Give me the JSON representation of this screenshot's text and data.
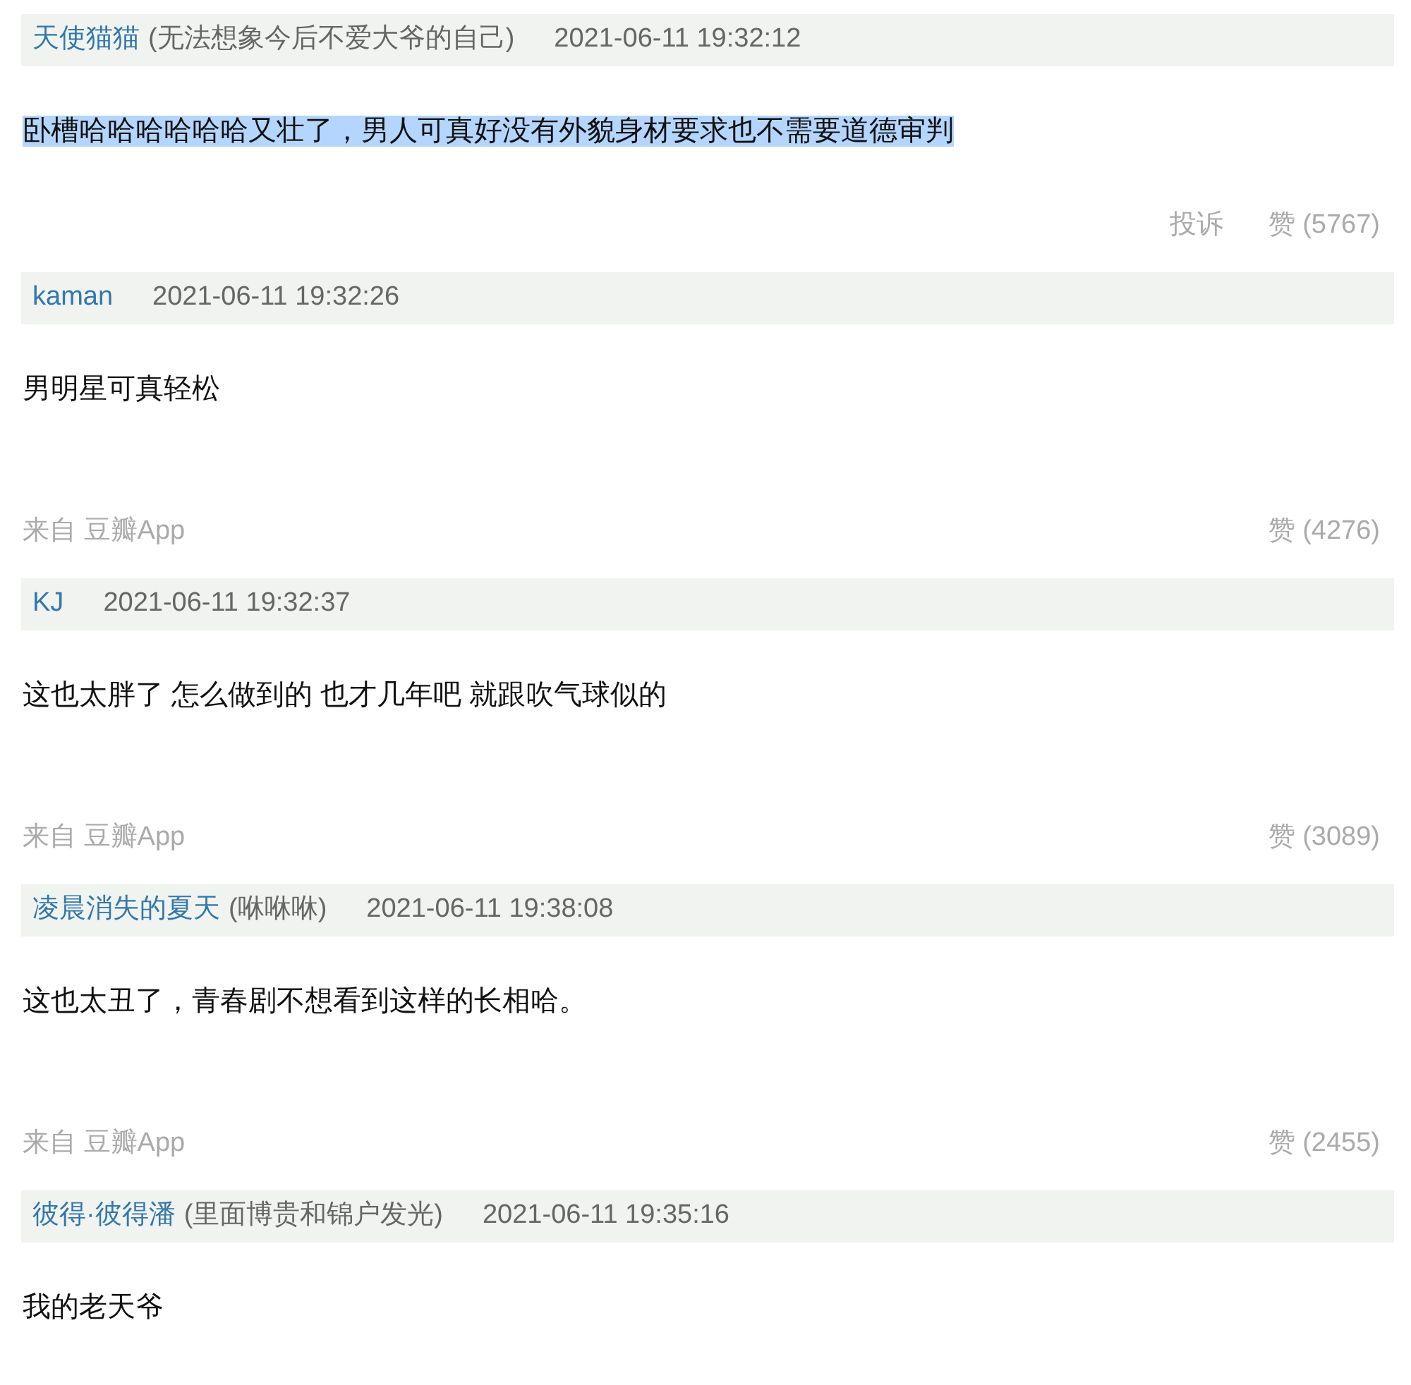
{
  "comments": [
    {
      "user": "天使猫猫",
      "note": "(无法想象今后不爱大爷的自己)",
      "time": "2021-06-11 19:32:12",
      "text": "卧槽哈哈哈哈哈哈又壮了，男人可真好没有外貌身材要求也不需要道德审判",
      "highlighted": true,
      "footer": {
        "report": "投诉",
        "likes": "赞 (5767)"
      }
    },
    {
      "user": "kaman",
      "time": "2021-06-11 19:32:26",
      "text": "男明星可真轻松",
      "highlighted": false,
      "footer": {
        "source": "来自 豆瓣App",
        "likes": "赞 (4276)"
      }
    },
    {
      "user": "KJ",
      "time": "2021-06-11 19:32:37",
      "text": "这也太胖了 怎么做到的 也才几年吧 就跟吹气球似的",
      "highlighted": false,
      "footer": {
        "source": "来自 豆瓣App",
        "likes": "赞 (3089)"
      }
    },
    {
      "user": "凌晨消失的夏天",
      "note": "(咻咻咻)",
      "time": "2021-06-11 19:38:08",
      "text": "这也太丑了，青春剧不想看到这样的长相哈。",
      "highlighted": false,
      "footer": {
        "source": "来自 豆瓣App",
        "likes": "赞 (2455)"
      }
    },
    {
      "user": "彼得·彼得潘",
      "note": "(里面博贵和锦户发光)",
      "time": "2021-06-11 19:35:16",
      "text": "我的老天爷",
      "highlighted": false
    }
  ]
}
